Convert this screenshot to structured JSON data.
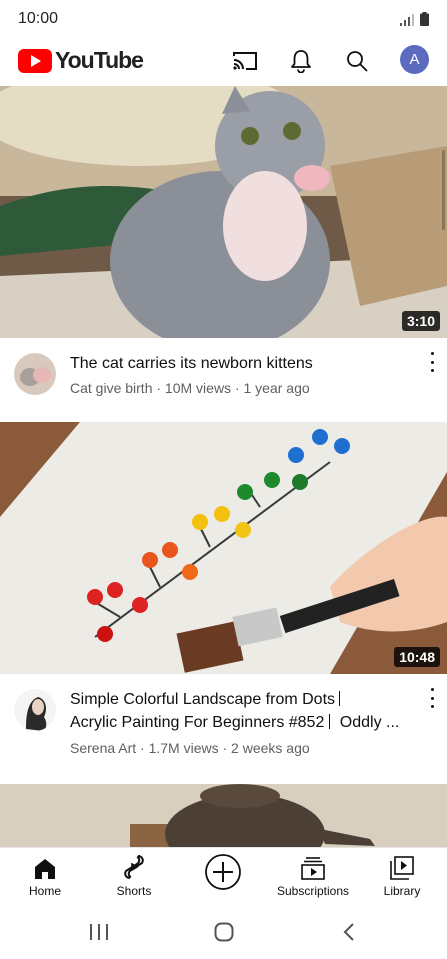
{
  "status_bar": {
    "time": "10:00"
  },
  "app_bar": {
    "logo_text": "YouTube",
    "brand_color": "#ff0000",
    "icons": [
      "cast-icon",
      "bell-icon",
      "search-icon"
    ],
    "avatar_letter": "A",
    "avatar_color": "#5c6bc0"
  },
  "videos": [
    {
      "title": "The cat carries its newborn kittens",
      "channel": "Cat give birth",
      "views": "10M views",
      "age": "1 year ago",
      "meta_line": "Cat give birth · 10M views · 1 year ago",
      "duration": "3:10"
    },
    {
      "title_line1": "Simple Colorful Landscape from Dots ",
      "title_line2": "Acrylic Painting For Beginners #852 ",
      "title_line2_tail": "Oddly ...",
      "channel": "Serena Art",
      "views": "1.7M views",
      "age": "2 weeks ago",
      "meta_line": "Serena Art · 1.7M views · 2 weeks ago",
      "duration": "10:48"
    }
  ],
  "bottom_nav": [
    {
      "label": "Home",
      "icon": "home-icon"
    },
    {
      "label": "Shorts",
      "icon": "shorts-icon"
    },
    {
      "label": "",
      "icon": "create-icon"
    },
    {
      "label": "Subscriptions",
      "icon": "subscriptions-icon"
    },
    {
      "label": "Library",
      "icon": "library-icon"
    }
  ],
  "system_nav": [
    "recents-icon",
    "home-circle-icon",
    "back-icon"
  ]
}
